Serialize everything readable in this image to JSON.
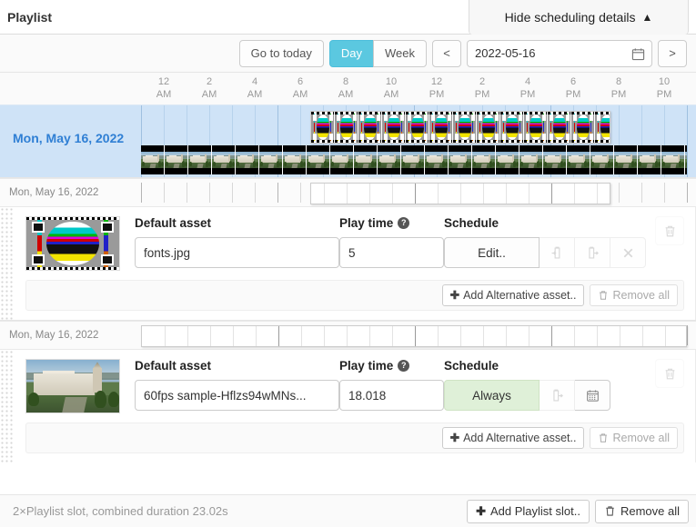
{
  "header": {
    "title": "Playlist",
    "hide_scheduling_label": "Hide scheduling details",
    "caret_icon": "chevron-up-icon"
  },
  "toolbar": {
    "go_to_today": "Go to today",
    "day": "Day",
    "week": "Week",
    "prev": "<",
    "next": ">",
    "date_value": "2022-05-16",
    "calendar_icon": "calendar-icon",
    "active_view": "Day",
    "accent_color": "#5bc8e0"
  },
  "axis": {
    "ticks": [
      "12 AM",
      "2 AM",
      "4 AM",
      "6 AM",
      "8 AM",
      "10 AM",
      "12 PM",
      "2 PM",
      "4 PM",
      "6 PM",
      "8 PM",
      "10 PM"
    ],
    "tick_numbers": [
      "12",
      "2",
      "4",
      "6",
      "8",
      "10",
      "12",
      "2",
      "4",
      "6",
      "8",
      "10"
    ],
    "tick_meridiems": [
      "AM",
      "AM",
      "AM",
      "AM",
      "AM",
      "AM",
      "PM",
      "PM",
      "PM",
      "PM",
      "PM",
      "PM"
    ]
  },
  "gantt": {
    "day_label": "Mon, May 16, 2022",
    "day_label_color": "#2f7fd4",
    "background_color": "#cfe3f7",
    "bars": [
      {
        "asset": "fonts.jpg",
        "thumb": "test-card",
        "start_pct": 31.0,
        "end_pct": 86.0,
        "row": 0
      },
      {
        "asset": "60fps sample-Hflzs94wMNs",
        "thumb": "photo",
        "start_pct": 0.0,
        "end_pct": 100.0,
        "row": 1
      }
    ]
  },
  "slots": [
    {
      "mini_label": "Mon, May 16, 2022",
      "mini_bar_start_pct": 31.0,
      "mini_bar_end_pct": 86.0,
      "thumb": "test-card",
      "default_asset_label": "Default asset",
      "asset_value": "fonts.jpg",
      "play_time_label": "Play time",
      "play_time_help_icon": "help-circle-icon",
      "play_time_value": "5",
      "schedule_label": "Schedule",
      "schedule_value": "Edit..",
      "schedule_is_always": false,
      "schedule_buttons": [
        "copy-schedule-icon",
        "paste-schedule-icon",
        "clear-schedule-icon"
      ],
      "delete_icon": "trash-icon",
      "add_alternative_label": "Add Alternative asset..",
      "add_alternative_icon": "plus-icon",
      "remove_all_label": "Remove all",
      "remove_all_icon": "trash-icon"
    },
    {
      "mini_label": "Mon, May 16, 2022",
      "mini_bar_start_pct": 0.0,
      "mini_bar_end_pct": 100.0,
      "thumb": "photo",
      "default_asset_label": "Default asset",
      "asset_value": "60fps sample-Hflzs94wMNs...",
      "play_time_label": "Play time",
      "play_time_help_icon": "help-circle-icon",
      "play_time_value": "18.018",
      "schedule_label": "Schedule",
      "schedule_value": "Always",
      "schedule_is_always": true,
      "schedule_buttons": [
        "paste-schedule-icon",
        "calendar-schedule-icon"
      ],
      "delete_icon": "trash-icon",
      "add_alternative_label": "Add Alternative asset..",
      "add_alternative_icon": "plus-icon",
      "remove_all_label": "Remove all",
      "remove_all_icon": "trash-icon"
    }
  ],
  "footer": {
    "summary": "2×Playlist slot, combined duration 23.02s",
    "add_slot_label": "Add Playlist slot..",
    "add_slot_icon": "plus-icon",
    "remove_all_label": "Remove all",
    "remove_all_icon": "trash-icon"
  }
}
